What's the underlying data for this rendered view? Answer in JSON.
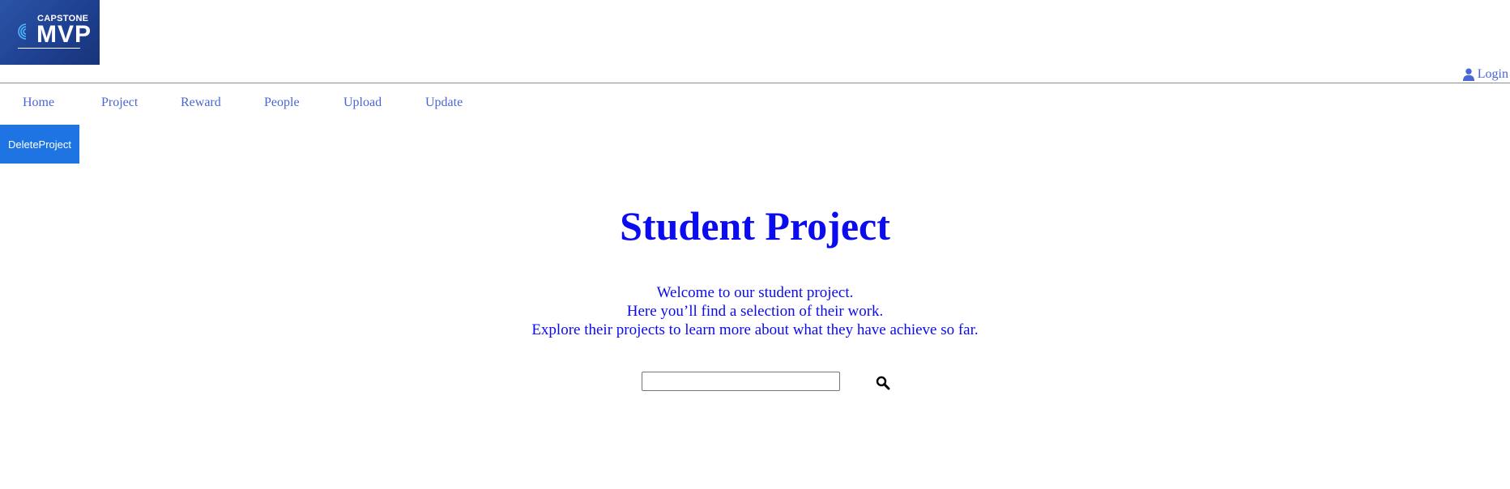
{
  "logo": {
    "top_text": "CAPSTONE",
    "main_text": "MVP",
    "icon": "wave-rings-icon"
  },
  "header": {
    "login_label": "Login",
    "login_icon": "user-icon"
  },
  "nav": {
    "items": [
      {
        "label": "Home"
      },
      {
        "label": "Project"
      },
      {
        "label": "Reward"
      },
      {
        "label": "People"
      },
      {
        "label": "Upload"
      },
      {
        "label": "Update"
      }
    ]
  },
  "actions": {
    "delete_project_label": "DeleteProject"
  },
  "hero": {
    "title": "Student Project",
    "lines": [
      "Welcome to our student project.",
      "Here you’ll find a selection of their work.",
      "Explore their projects to learn more about what they have achieve so far."
    ]
  },
  "search": {
    "value": "",
    "placeholder": "",
    "icon": "search-icon"
  },
  "colors": {
    "link": "#4a66d6",
    "heading": "#0b0bf0",
    "button_bg": "#1f74e3",
    "logo_bg": "#1e3f8f"
  }
}
